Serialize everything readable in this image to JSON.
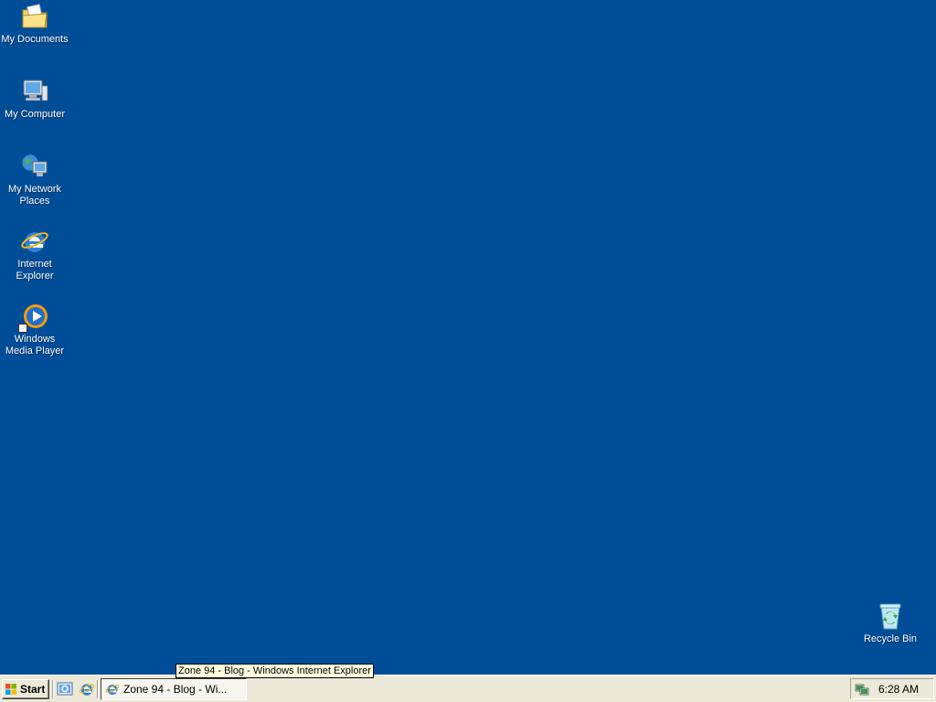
{
  "desktop": {
    "background_color": "#004e98",
    "icons": [
      {
        "label": "My Documents",
        "icon": "folder-documents-icon"
      },
      {
        "label": "My Computer",
        "icon": "computer-icon"
      },
      {
        "label": "My Network Places",
        "icon": "network-places-icon"
      },
      {
        "label": "Internet Explorer",
        "icon": "internet-explorer-icon"
      },
      {
        "label": "Windows Media Player",
        "icon": "media-player-icon"
      },
      {
        "label": "Recycle Bin",
        "icon": "recycle-bin-icon"
      }
    ]
  },
  "tooltip": {
    "text": "Zone 94 - Blog - Windows Internet Explorer"
  },
  "taskbar": {
    "start_label": "Start",
    "quick_launch": [
      {
        "icon": "show-desktop-icon"
      },
      {
        "icon": "internet-explorer-icon"
      }
    ],
    "task": {
      "label": "Zone 94 - Blog - Wi...",
      "icon": "internet-explorer-icon"
    },
    "tray": {
      "icon": "network-connection-icon",
      "clock": "6:28 AM"
    }
  }
}
